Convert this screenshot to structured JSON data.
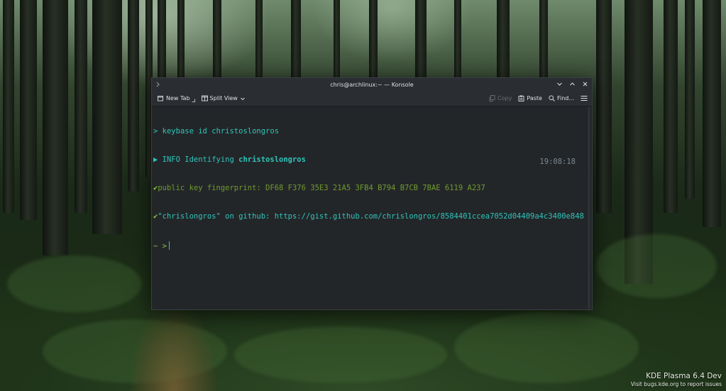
{
  "window": {
    "title": "chris@archlinux:~ — Konsole",
    "icon": "konsole-icon"
  },
  "toolbar": {
    "new_tab_label": "New Tab",
    "split_view_label": "Split View",
    "copy_label": "Copy",
    "paste_label": "Paste",
    "find_label": "Find..."
  },
  "terminal": {
    "prompt_symbol": ">",
    "command": "keybase id christoslongros",
    "info_arrow": "▶",
    "info_prefix": "INFO Identifying ",
    "info_user": "christoslongros",
    "check_mark": "✔",
    "fingerprint_line": "public key fingerprint: DF68 F376 35E3 21A5 3FB4 B794 B7CB 7BAE 6119 A237",
    "github_line": "\"chrislongros\" on github: https://gist.github.com/chrislongros/8584401ccea7052d04409a4c3400e848",
    "prompt_dir": "~",
    "prompt_arrow": ">",
    "timestamp": "19:08:18"
  },
  "desktop": {
    "plasma_version": "KDE Plasma 6.4 Dev",
    "report_notice": "Visit bugs.kde.org to report issues"
  },
  "colors": {
    "terminal_bg": "#232629",
    "prompt_cyan": "#2fc4b9",
    "check_green": "#8ec43a",
    "titlebar_bg": "#2a2e32"
  }
}
